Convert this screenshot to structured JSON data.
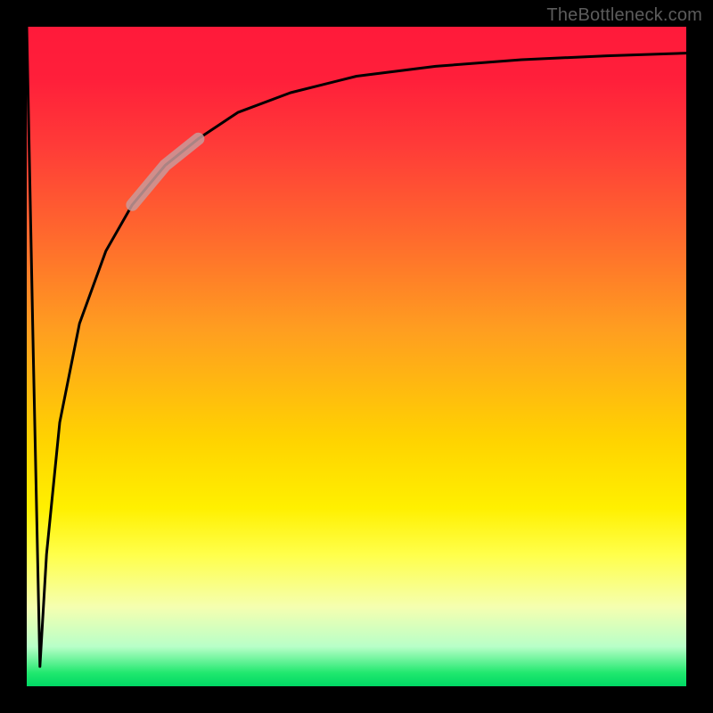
{
  "watermark": "TheBottleneck.com",
  "chart_data": {
    "type": "line",
    "title": "",
    "xlabel": "",
    "ylabel": "",
    "xlim": [
      0,
      100
    ],
    "ylim": [
      0,
      100
    ],
    "grid": false,
    "legend": false,
    "series": [
      {
        "name": "primary-curve",
        "x": [
          0,
          1,
          2,
          3,
          5,
          8,
          12,
          16,
          21,
          26,
          32,
          40,
          50,
          62,
          75,
          88,
          100
        ],
        "y": [
          100,
          50,
          3,
          20,
          40,
          55,
          66,
          73,
          79,
          83,
          87,
          90,
          92.5,
          94,
          95,
          95.6,
          96
        ]
      },
      {
        "name": "highlight-segment",
        "x": [
          16,
          21,
          26
        ],
        "y": [
          73,
          79,
          83
        ]
      }
    ],
    "annotations": []
  }
}
